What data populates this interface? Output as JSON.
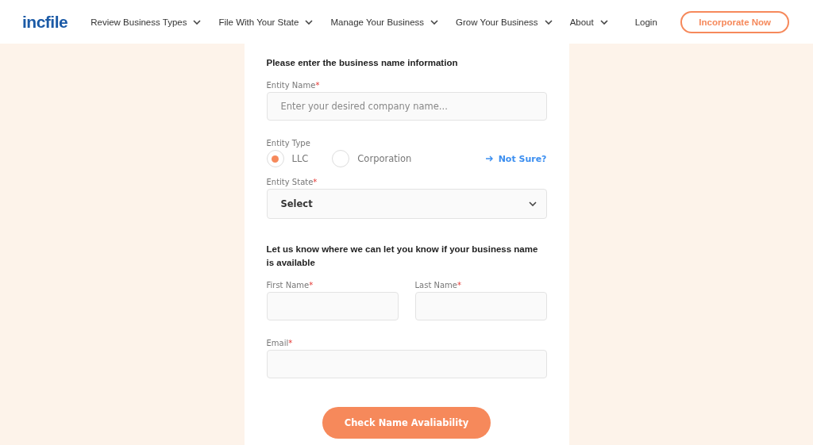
{
  "header": {
    "logo": "incfile",
    "nav": [
      {
        "label": "Review Business Types",
        "dropdown": true
      },
      {
        "label": "File With Your State",
        "dropdown": true
      },
      {
        "label": "Manage Your Business",
        "dropdown": true
      },
      {
        "label": "Grow Your Business",
        "dropdown": true
      },
      {
        "label": "About",
        "dropdown": true
      },
      {
        "label": "Login",
        "dropdown": false
      }
    ],
    "cta": "Incorporate Now"
  },
  "form": {
    "section_1_title": "Please enter the business name information",
    "entity_name": {
      "label": "Entity Name",
      "required": "*",
      "placeholder": "Enter your desired company name..."
    },
    "entity_type": {
      "label": "Entity Type",
      "options": [
        {
          "label": "LLC",
          "selected": true
        },
        {
          "label": "Corporation",
          "selected": false
        }
      ],
      "help_link": "Not Sure?"
    },
    "entity_state": {
      "label": "Entity State",
      "required": "*",
      "value": "Select"
    },
    "section_2_title": "Let us know where we can let you know if your business name is available",
    "first_name": {
      "label": "First Name",
      "required": "*"
    },
    "last_name": {
      "label": "Last Name",
      "required": "*"
    },
    "email": {
      "label": "Email",
      "required": "*"
    },
    "submit": "Check Name Avaliability"
  }
}
